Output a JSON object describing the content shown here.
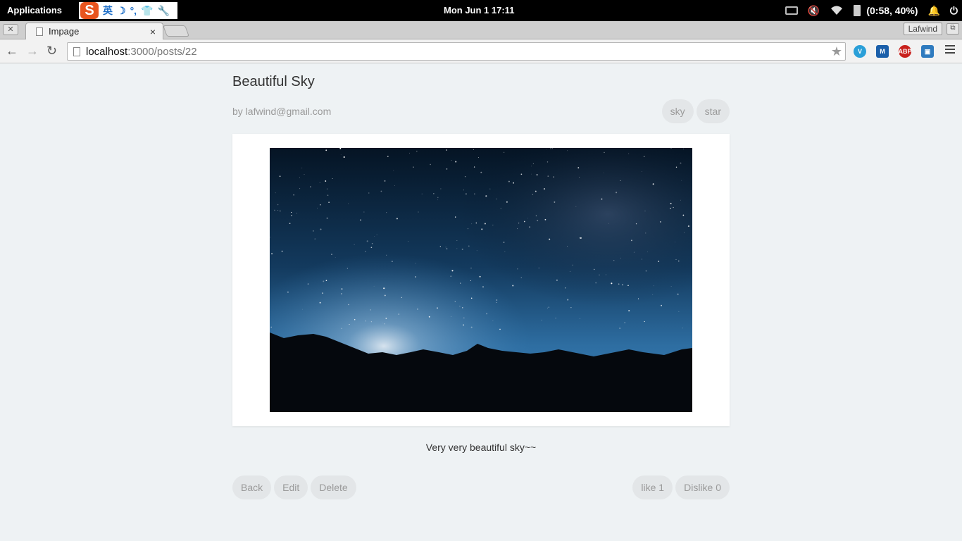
{
  "system": {
    "applications_label": "Applications",
    "ime": {
      "logo": "S",
      "items": [
        "英",
        "☽",
        "°,",
        "👕",
        "🔧"
      ]
    },
    "clock": "Mon Jun  1    17:11",
    "battery": "(0:58, 40%)"
  },
  "browser": {
    "tab_title": "Impage",
    "tab_close": "×",
    "window_close": "✕",
    "profile_name": "Lafwind",
    "url_host": "localhost",
    "url_rest": ":3000/posts/22",
    "nav": {
      "back": "←",
      "forward": "→",
      "reload": "↻",
      "star": "★"
    },
    "extensions": [
      {
        "name": "v-extension-icon",
        "label": "V",
        "color": "#2a9fd8"
      },
      {
        "name": "m-extension-icon",
        "label": "M",
        "color": "#1b5faa"
      },
      {
        "name": "adblock-plus-icon",
        "label": "ABP",
        "color": "#c8201c"
      },
      {
        "name": "box-extension-icon",
        "label": "▣",
        "color": "#2f7bbf"
      }
    ]
  },
  "post": {
    "title": "Beautiful Sky",
    "author": "by lafwind@gmail.com",
    "tags": [
      "sky",
      "star"
    ],
    "description": "Very very beautiful sky~~",
    "buttons": {
      "back": "Back",
      "edit": "Edit",
      "delete": "Delete",
      "like": "like 1",
      "dislike": "Dislike 0"
    }
  }
}
